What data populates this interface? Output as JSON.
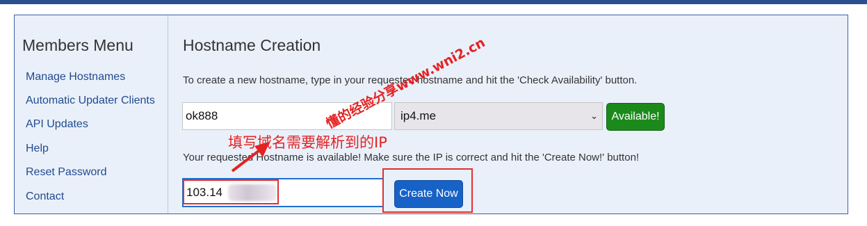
{
  "sidebar": {
    "title": "Members Menu",
    "items": [
      {
        "label": "Manage Hostnames"
      },
      {
        "label": "Automatic Updater Clients"
      },
      {
        "label": "API Updates"
      },
      {
        "label": "Help"
      },
      {
        "label": "Reset Password"
      },
      {
        "label": "Contact"
      }
    ]
  },
  "main": {
    "title": "Hostname Creation",
    "instructions": "To create a new hostname, type in your requested hostname and hit the 'Check Availability' button.",
    "hostname_value": "ok888",
    "domain_selected": "ip4.me",
    "available_label": "Available!",
    "result_message": "Your requested Hostname is available! Make sure the IP is correct and hit the 'Create Now!' button!",
    "ip_value": "103.14",
    "create_label": "Create Now"
  },
  "annotations": {
    "instruction_cn": "填写域名需要解析到的IP",
    "watermark": "懂的经验分享www.wni2.cn"
  },
  "colors": {
    "top_bar": "#2a4f8f",
    "panel_bg": "#eaf0fa",
    "link": "#1f4b8e",
    "available_button": "#1b8a1b",
    "create_button": "#1762c6",
    "annotation_red": "#e52222"
  }
}
